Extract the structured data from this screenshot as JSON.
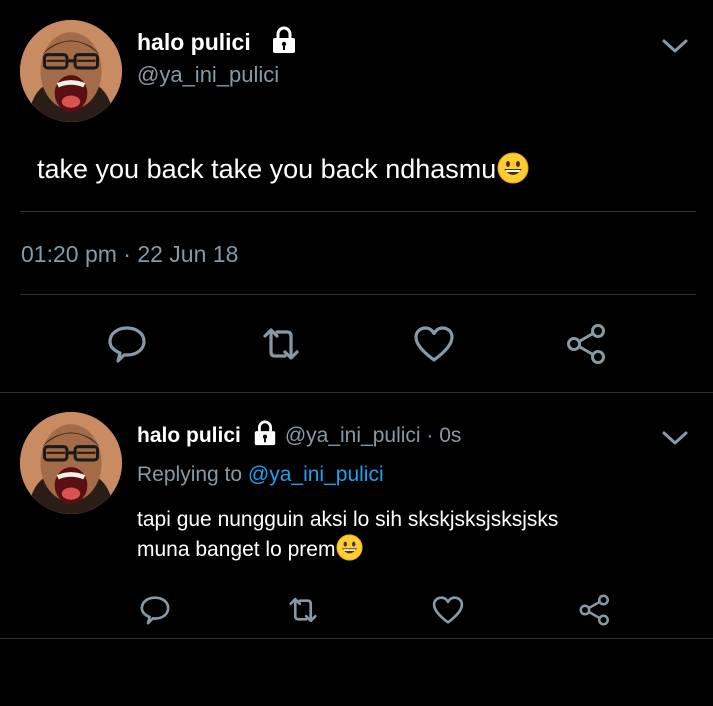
{
  "main_tweet": {
    "display_name": "halo pulici",
    "handle": "@ya_ini_pulici",
    "text": "take you back take you back ndhasmu",
    "emoji": "grinning-face",
    "timestamp": "01:20 pm · 22 Jun 18",
    "actions": [
      {
        "name": "reply",
        "icon": "comment-icon"
      },
      {
        "name": "retweet",
        "icon": "retweet-icon"
      },
      {
        "name": "like",
        "icon": "heart-icon"
      },
      {
        "name": "share",
        "icon": "share-icon"
      }
    ]
  },
  "reply_tweet": {
    "display_name": "halo pulici",
    "handle": "@ya_ini_pulici",
    "separator": " · ",
    "time_ago": "0s",
    "replying_label": "Replying to ",
    "replying_to": "@ya_ini_pulici",
    "text_line1": "tapi gue nungguin aksi lo sih skskjsksjsksjsks",
    "text_line2": "muna banget lo prem",
    "emoji": "grinning-face"
  },
  "colors": {
    "background": "#000000",
    "primary_text": "#ffffff",
    "secondary_text": "#8899a6",
    "accent": "#1da1f2",
    "divider": "#2f3336"
  }
}
